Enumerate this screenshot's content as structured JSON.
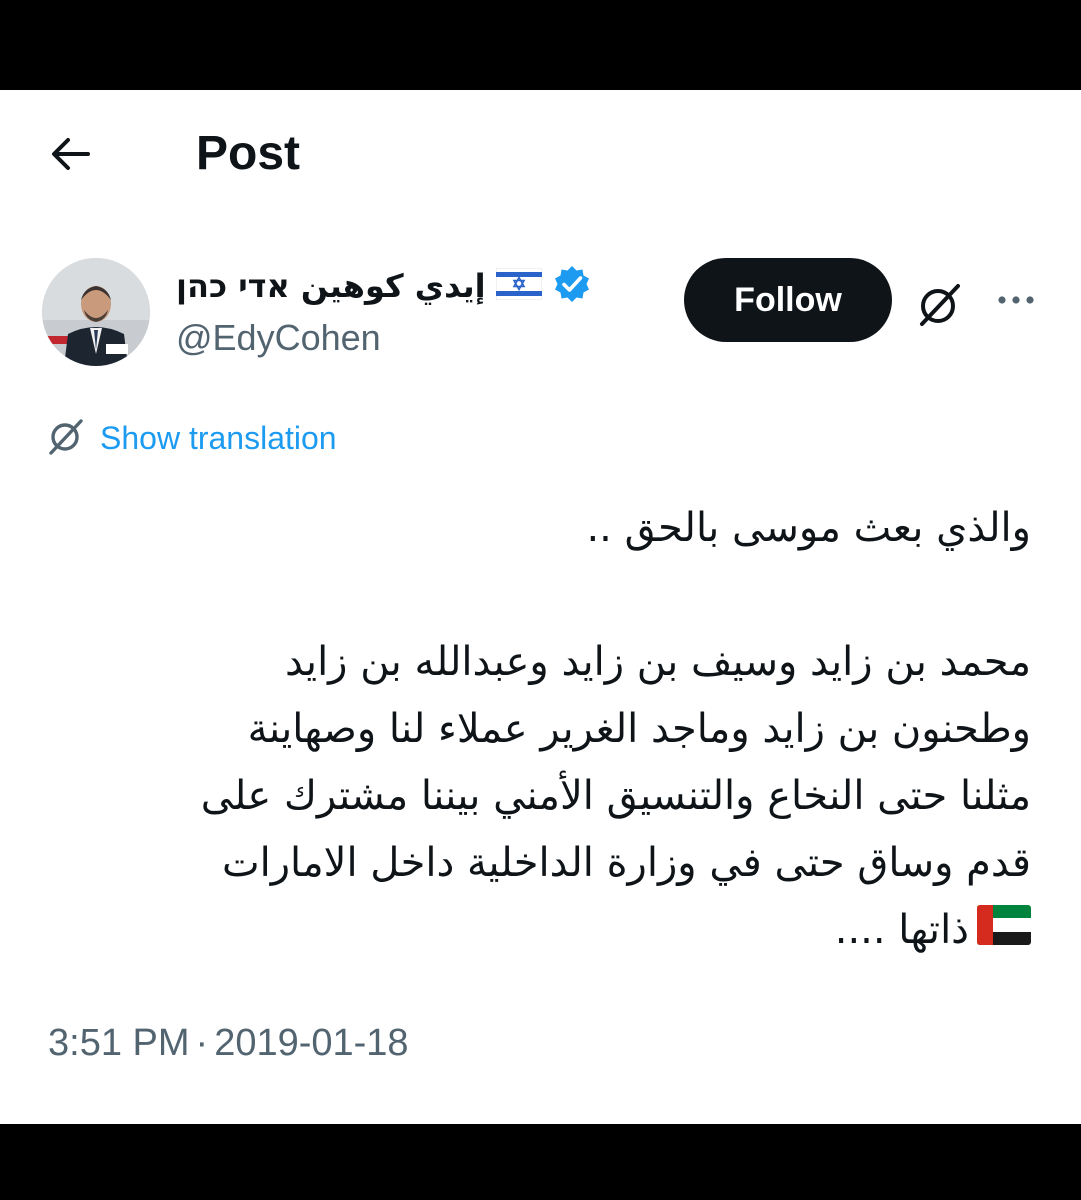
{
  "header": {
    "title": "Post"
  },
  "author": {
    "display_name": "إيدي كوهين אדי כהן",
    "handle": "@EdyCohen",
    "verified": true,
    "flag": "israel-flag"
  },
  "actions": {
    "follow_label": "Follow"
  },
  "translation": {
    "label": "Show translation"
  },
  "tweet": {
    "lines": [
      "والذي بعث موسى بالحق ..",
      "",
      "محمد بن زايد وسيف بن زايد وعبدالله بن زايد",
      "وطحنون بن زايد وماجد الغرير عملاء لنا وصهاينة",
      "مثلنا حتى النخاع والتنسيق الأمني بيننا مشترك على",
      "قدم وساق حتى في وزارة الداخلية داخل الامارات",
      "ذاتها ...."
    ],
    "emoji": "uae-flag"
  },
  "meta": {
    "time": "3:51 PM",
    "separator": "·",
    "date": "2019-01-18"
  },
  "colors": {
    "text": "#0f1419",
    "secondary": "#536471",
    "link": "#1d9bf0",
    "verified": "#1d9bf0",
    "button": "#0f1419"
  }
}
